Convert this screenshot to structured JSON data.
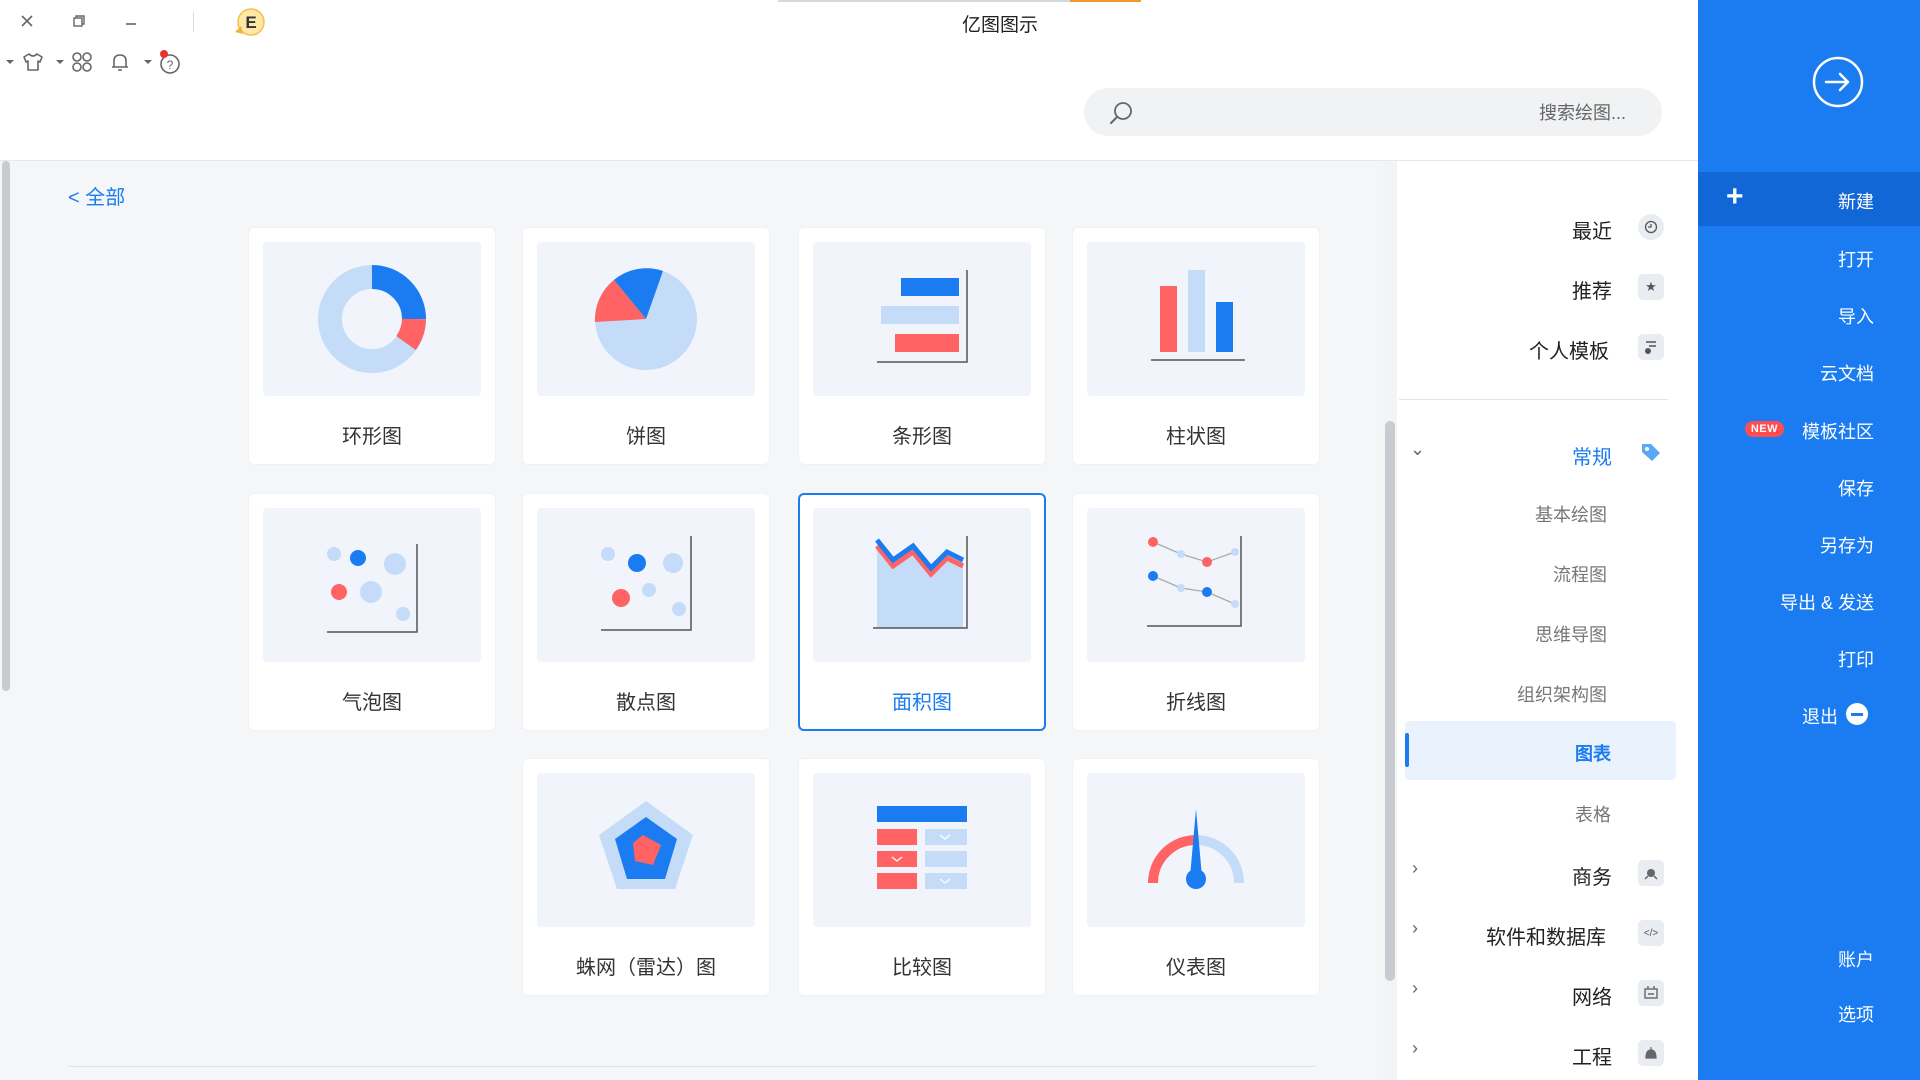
{
  "app": {
    "title": "亿图图示"
  },
  "window_controls": [
    "close-icon",
    "restore-icon",
    "minimize-icon"
  ],
  "toolbar_icons": [
    "theme-dropdown-icon",
    "shirt-icon",
    "apps-grid-icon",
    "bell-icon",
    "help-icon",
    "avatar-badge-icon"
  ],
  "avatar_letter": "E",
  "search": {
    "placeholder": "搜索绘图..."
  },
  "blue_panel": {
    "new": "新建",
    "open": "打开",
    "import": "导入",
    "cloud": "云文档",
    "template_community": "模板社区",
    "new_badge": "NEW",
    "save": "保存",
    "save_as": "另存为",
    "export_send": "导出 & 发送",
    "print": "打印",
    "exit": "退出",
    "account": "账户",
    "options": "选项"
  },
  "sidebar": {
    "top_items": [
      "最近",
      "推荐",
      "个人模板"
    ],
    "group": "常规",
    "sub_items": [
      "基本绘图",
      "流程图",
      "思维导图",
      "组织架构图",
      "图表",
      "表格"
    ],
    "selected": "图表",
    "more_groups": [
      "商务",
      "软件和数据库",
      "网络",
      "工程"
    ]
  },
  "breadcrumb": "< 全部",
  "cards": [
    {
      "label": "柱状图",
      "thumb": "bar-chart"
    },
    {
      "label": "条形图",
      "thumb": "horizontal-bar-chart"
    },
    {
      "label": "饼图",
      "thumb": "pie-chart"
    },
    {
      "label": "环形图",
      "thumb": "donut-chart"
    },
    {
      "label": "折线图",
      "thumb": "line-chart"
    },
    {
      "label": "面积图",
      "thumb": "area-chart"
    },
    {
      "label": "散点图",
      "thumb": "scatter-chart"
    },
    {
      "label": "气泡图",
      "thumb": "bubble-chart"
    },
    {
      "label": "仪表图",
      "thumb": "gauge-chart"
    },
    {
      "label": "比较图",
      "thumb": "comparison-chart"
    },
    {
      "label": "蛛网（雷达）图",
      "thumb": "radar-chart"
    }
  ],
  "colors": {
    "accent": "#1a7cf0",
    "red": "#ff6363",
    "light_blue": "#c4dcf8",
    "panel": "#1a7cf0"
  }
}
